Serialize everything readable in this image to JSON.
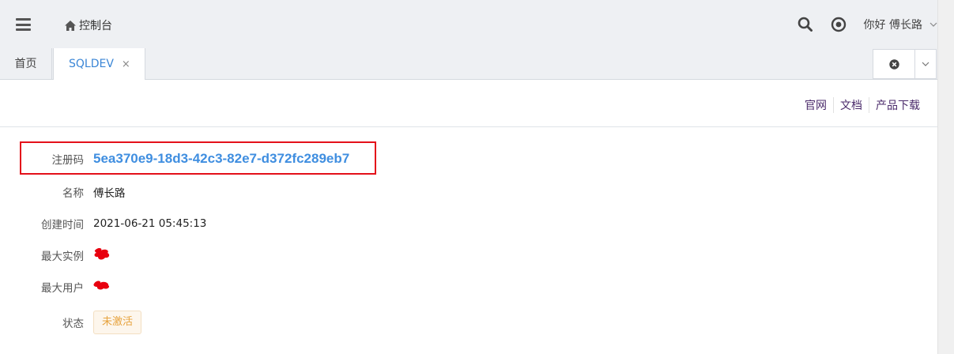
{
  "header": {
    "breadcrumb": "控制台",
    "greeting": "你好 傅长路"
  },
  "tabs": [
    {
      "label": "首页"
    },
    {
      "label": "SQLDEV",
      "close": "×"
    }
  ],
  "links": [
    "官网",
    "文档",
    "产品下载"
  ],
  "fields": {
    "registration": {
      "label": "注册码",
      "value": "5ea370e9-18d3-42c3-82e7-d372fc289eb7"
    },
    "name": {
      "label": "名称",
      "value": "傅长路"
    },
    "created": {
      "label": "创建时间",
      "value": "2021-06-21 05:45:13"
    },
    "max_instances": {
      "label": "最大实例"
    },
    "max_users": {
      "label": "最大用户"
    },
    "status": {
      "label": "状态",
      "value": "未激活"
    }
  },
  "colors": {
    "accent": "#3b86d6",
    "highlight_border": "#e4101a",
    "status_badge": "#e6a23c",
    "redaction": "#e8000f"
  },
  "icons": [
    "menu-icon",
    "home-icon",
    "search-icon",
    "target-icon",
    "chevron-down-icon",
    "close-circle-icon"
  ]
}
